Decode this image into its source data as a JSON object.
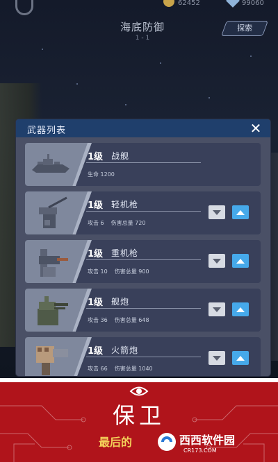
{
  "header": {
    "title": "海底防御",
    "level": "1 - 1",
    "explore_label": "探索",
    "coins": "62452",
    "gems": "99060"
  },
  "modal": {
    "title": "武器列表",
    "items": [
      {
        "level": "1级",
        "name": "战舰",
        "stats": [
          "生命 1200"
        ],
        "has_controls": false
      },
      {
        "level": "1级",
        "name": "轻机枪",
        "stats": [
          "攻击 6",
          "伤害总量 720"
        ],
        "has_controls": true
      },
      {
        "level": "1级",
        "name": "重机枪",
        "stats": [
          "攻击 10",
          "伤害总量 900"
        ],
        "has_controls": true
      },
      {
        "level": "1级",
        "name": "舰炮",
        "stats": [
          "攻击 36",
          "伤害总量 648"
        ],
        "has_controls": true
      },
      {
        "level": "1级",
        "name": "火箭炮",
        "stats": [
          "攻击 66",
          "伤害总量 1040"
        ],
        "has_controls": true
      }
    ]
  },
  "banner": {
    "title": "保卫",
    "subtitle": "最后的",
    "watermark": "西西软件园",
    "watermark_url": "CR173.COM"
  },
  "colors": {
    "modal_header": "#1f3f6c",
    "card_bg": "#39405a",
    "up_button": "#46a9ea",
    "banner_red": "#b0141b",
    "banner_gold": "#f4d15a"
  }
}
